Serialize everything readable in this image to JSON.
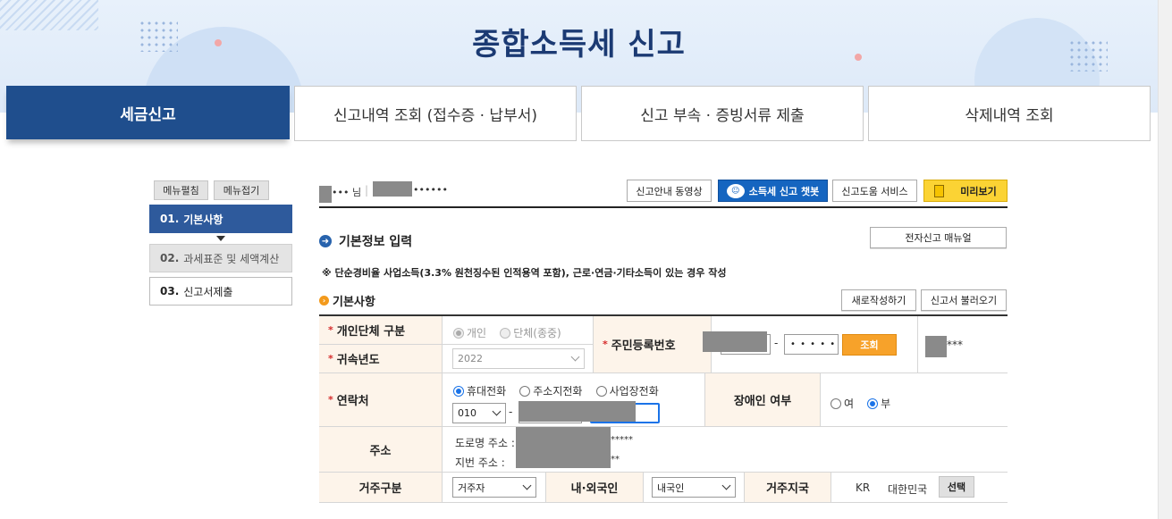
{
  "header": {
    "title": "종합소득세 신고"
  },
  "tabs": [
    {
      "label": "세금신고"
    },
    {
      "label": "신고내역 조회 (접수증 · 납부서)"
    },
    {
      "label": "신고 부속 · 증빙서류 제출"
    },
    {
      "label": "삭제내역 조회"
    }
  ],
  "sidebar": {
    "expand_all": "메뉴펼침",
    "collapse_all": "메뉴접기",
    "items": [
      {
        "num": "01.",
        "label": "기본사항"
      },
      {
        "num": "02.",
        "label": "과세표준 및 세액계산"
      },
      {
        "num": "03.",
        "label": "신고서제출"
      }
    ]
  },
  "user": {
    "name_suffix": "••• 님",
    "id_suffix": "••••••"
  },
  "top_buttons": {
    "video": "신고안내 동영상",
    "chatbot": "소득세 신고 챗봇",
    "help": "신고도움 서비스",
    "preview": "미리보기"
  },
  "section": {
    "title": "기본정보 입력",
    "manual_button": "전자신고 매뉴얼",
    "notice": "※ 단순경비율 사업소득(3.3% 원천징수된 인적용역 포함), 근로·연금·기타소득이 있는 경우 작성",
    "subtitle": "기본사항",
    "new_button": "새로작성하기",
    "load_button": "신고서 불러오기"
  },
  "form": {
    "entity_type": {
      "label": "개인단체 구분",
      "opt1": "개인",
      "opt2": "단체(종중)",
      "selected": "개인"
    },
    "year": {
      "label": "귀속년도",
      "value": "2022"
    },
    "resident_id": {
      "label": "주민등록번호",
      "dash": "-",
      "second": "• • • • •",
      "button": "조회",
      "result_suffix": "***"
    },
    "contact": {
      "label": "연락처",
      "opt1": "휴대전화",
      "opt2": "주소지전화",
      "opt3": "사업장전화",
      "selected": "휴대전화",
      "prefix": "010",
      "dash": "-"
    },
    "disability": {
      "label": "장애인 여부",
      "yes": "여",
      "no": "부",
      "selected": "부"
    },
    "address": {
      "label": "주소",
      "road_label": "도로명 주소 :",
      "road_suffix": "*****",
      "lot_label": "지번 주소 :",
      "lot_suffix": "**"
    },
    "residence": {
      "label": "거주구분",
      "value": "거주자"
    },
    "nationality": {
      "label": "내·외국인",
      "value": "내국인"
    },
    "country": {
      "label": "거주지국",
      "code": "KR",
      "name": "대한민국",
      "button": "선택"
    }
  },
  "colors": {
    "primary": "#1f4e8d",
    "accent": "#f7a22a",
    "label_bg": "#fdf4ea",
    "chatbot": "#1565c0",
    "preview": "#fbd334"
  }
}
